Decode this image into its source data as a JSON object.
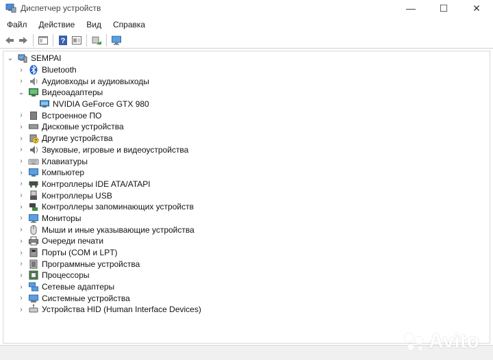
{
  "window": {
    "title": "Диспетчер устройств",
    "controls": [
      "—",
      "☐",
      "✕"
    ]
  },
  "menu": [
    "Файл",
    "Действие",
    "Вид",
    "Справка"
  ],
  "toolbar": {
    "buttons": [
      "back-icon",
      "forward-icon",
      "properties-icon",
      "help-icon",
      "show-hidden-icon",
      "scan-hardware-icon",
      "monitor-icon"
    ]
  },
  "tree": {
    "root": "SEMPAI",
    "categories": [
      {
        "label": "Bluetooth",
        "icon": "bluetooth-icon",
        "expanded": false
      },
      {
        "label": "Аудиовходы и аудиовыходы",
        "icon": "speaker-icon",
        "expanded": false
      },
      {
        "label": "Видеоадаптеры",
        "icon": "display-adapter-icon",
        "expanded": true,
        "children": [
          "NVIDIA GeForce GTX 980"
        ]
      },
      {
        "label": "Встроенное ПО",
        "icon": "firmware-icon",
        "expanded": false
      },
      {
        "label": "Дисковые устройства",
        "icon": "disk-icon",
        "expanded": false
      },
      {
        "label": "Другие устройства",
        "icon": "unknown-device-icon",
        "expanded": false
      },
      {
        "label": "Звуковые, игровые и видеоустройства",
        "icon": "sound-icon",
        "expanded": false
      },
      {
        "label": "Клавиатуры",
        "icon": "keyboard-icon",
        "expanded": false
      },
      {
        "label": "Компьютер",
        "icon": "computer-icon",
        "expanded": false
      },
      {
        "label": "Контроллеры IDE ATA/ATAPI",
        "icon": "ide-controller-icon",
        "expanded": false
      },
      {
        "label": "Контроллеры USB",
        "icon": "usb-icon",
        "expanded": false
      },
      {
        "label": "Контроллеры запоминающих устройств",
        "icon": "storage-controller-icon",
        "expanded": false
      },
      {
        "label": "Мониторы",
        "icon": "monitor-icon",
        "expanded": false
      },
      {
        "label": "Мыши и иные указывающие устройства",
        "icon": "mouse-icon",
        "expanded": false
      },
      {
        "label": "Очереди печати",
        "icon": "printer-icon",
        "expanded": false
      },
      {
        "label": "Порты (COM и LPT)",
        "icon": "port-icon",
        "expanded": false
      },
      {
        "label": "Программные устройства",
        "icon": "software-device-icon",
        "expanded": false
      },
      {
        "label": "Процессоры",
        "icon": "processor-icon",
        "expanded": false
      },
      {
        "label": "Сетевые адаптеры",
        "icon": "network-adapter-icon",
        "expanded": false
      },
      {
        "label": "Системные устройства",
        "icon": "system-device-icon",
        "expanded": false
      },
      {
        "label": "Устройства HID (Human Interface Devices)",
        "icon": "hid-icon",
        "expanded": false
      }
    ]
  },
  "watermark": "Avito"
}
